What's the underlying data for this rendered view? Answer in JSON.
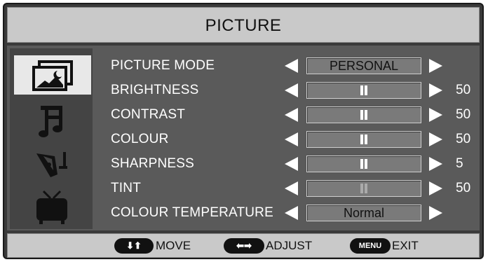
{
  "menu": {
    "title": "PICTURE"
  },
  "sidebar": {
    "items": [
      {
        "icon": "picture-icon",
        "selected": true
      },
      {
        "icon": "music-note-icon",
        "selected": false
      },
      {
        "icon": "setup-pen-icon",
        "selected": false
      },
      {
        "icon": "tv-icon",
        "selected": false
      }
    ]
  },
  "settings": [
    {
      "label": "PICTURE MODE",
      "type": "option",
      "value": "PERSONAL"
    },
    {
      "label": "BRIGHTNESS",
      "type": "slider",
      "value": "50",
      "level": 0.5,
      "enabled": true
    },
    {
      "label": "CONTRAST",
      "type": "slider",
      "value": "50",
      "level": 0.5,
      "enabled": true
    },
    {
      "label": "COLOUR",
      "type": "slider",
      "value": "50",
      "level": 0.5,
      "enabled": true
    },
    {
      "label": "SHARPNESS",
      "type": "slider",
      "value": "5",
      "level": 0.5,
      "enabled": true
    },
    {
      "label": "TINT",
      "type": "slider",
      "value": "50",
      "level": 0.5,
      "enabled": false
    },
    {
      "label": "COLOUR TEMPERATURE",
      "type": "option",
      "value": "Normal"
    }
  ],
  "footer": {
    "move": {
      "button": "up-down-arrows-icon",
      "label": "MOVE"
    },
    "adjust": {
      "button": "left-right-arrows-icon",
      "label": "ADJUST"
    },
    "exit": {
      "button_label": "MENU",
      "label": "EXIT"
    }
  },
  "colors": {
    "panel": "#5a5a5a",
    "sidebar": "#444444",
    "header": "#c9c9c9",
    "slider_box": "#7a7a7a",
    "text": "#ffffff"
  }
}
